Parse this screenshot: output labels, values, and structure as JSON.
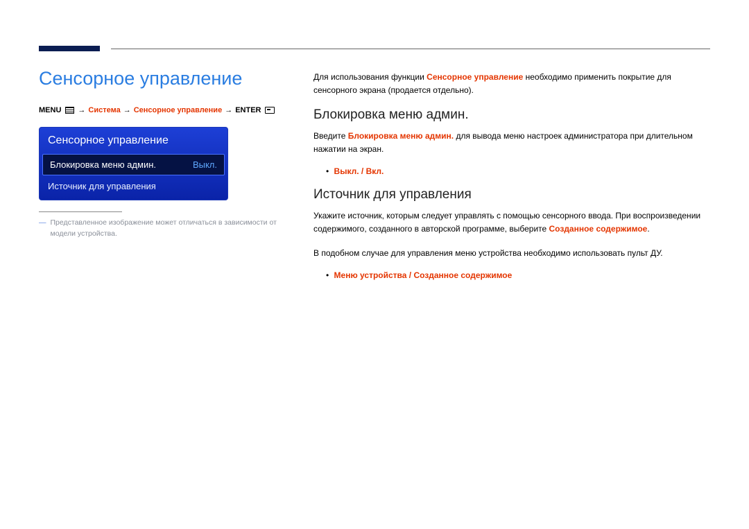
{
  "pageTitle": "Сенсорное управление",
  "breadcrumb": {
    "menu": "MENU",
    "sys": "Система",
    "touch": "Сенсорное управление",
    "enter": "ENTER",
    "arrow": "→"
  },
  "osd": {
    "title": "Сенсорное управление",
    "row1": {
      "label": "Блокировка меню админ.",
      "value": "Выкл."
    },
    "row2": {
      "label": "Источник для управления"
    }
  },
  "footnote": {
    "dash": "―",
    "text": "Представленное изображение может отличаться в зависимости от модели устройства."
  },
  "intro": {
    "pre": "Для использования функции ",
    "hl": "Сенсорное управление",
    "post": " необходимо применить покрытие для сенсорного экрана (продается отдельно)."
  },
  "section1": {
    "heading": "Блокировка меню админ.",
    "bodyPre": "Введите ",
    "bodyHl": "Блокировка меню админ.",
    "bodyPost": " для вывода меню настроек администратора при длительном нажатии на экран.",
    "bullet": "Выкл. / Вкл."
  },
  "section2": {
    "heading": "Источник для управления",
    "body1Pre": "Укажите источник, которым следует управлять с помощью сенсорного ввода. При воспроизведении содержимого, созданного в авторской программе, выберите ",
    "body1Hl": "Созданное содержимое",
    "body1Post": ".",
    "body2": "В подобном случае для управления меню устройства необходимо использовать пульт ДУ.",
    "bullet": "Меню устройства / Созданное содержимое"
  }
}
